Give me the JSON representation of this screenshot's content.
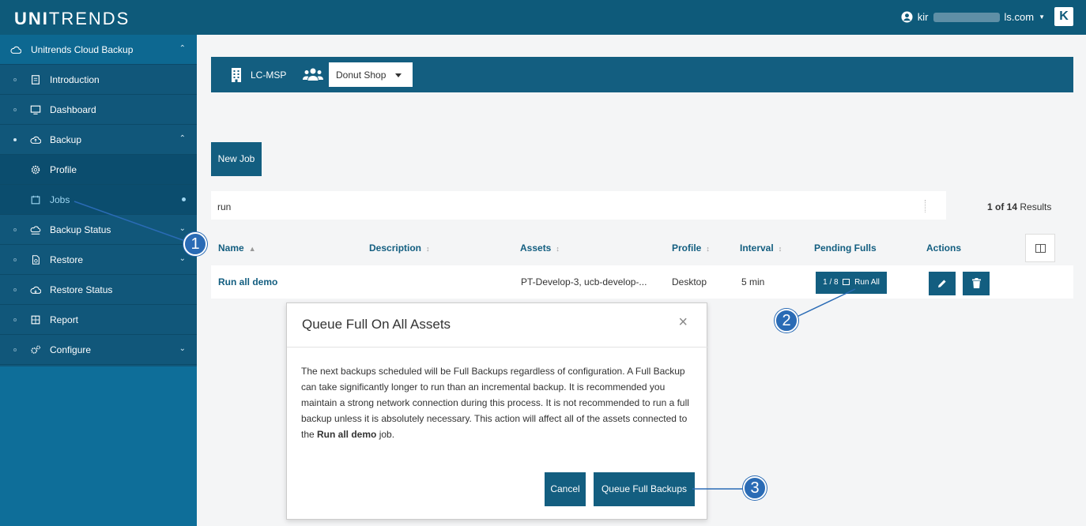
{
  "header": {
    "brand_bold": "UNI",
    "brand_rest": "TRENDS",
    "user_prefix": "kir",
    "user_suffix": "ls.com",
    "logo_letter": "K"
  },
  "sidebar": {
    "items": [
      {
        "label": "Unitrends Cloud Backup",
        "icon": "cloud-icon"
      },
      {
        "label": "Introduction",
        "icon": "document-icon"
      },
      {
        "label": "Dashboard",
        "icon": "monitor-icon"
      },
      {
        "label": "Backup",
        "icon": "cloud-upload-icon"
      },
      {
        "label": "Profile",
        "icon": "gear-icon"
      },
      {
        "label": "Jobs",
        "icon": "calendar-icon"
      },
      {
        "label": "Backup Status",
        "icon": "backup-status-icon"
      },
      {
        "label": "Restore",
        "icon": "file-restore-icon"
      },
      {
        "label": "Restore Status",
        "icon": "cloud-restore-icon"
      },
      {
        "label": "Report",
        "icon": "table-icon"
      },
      {
        "label": "Configure",
        "icon": "gears-icon"
      }
    ]
  },
  "context": {
    "org": "LC-MSP",
    "group": "Donut Shop"
  },
  "toolbar": {
    "new_job": "New Job"
  },
  "search": {
    "value": "run",
    "results_count": "1 of 14",
    "results_label": " Results"
  },
  "table": {
    "headers": [
      "Name",
      "Description",
      "Assets",
      "Profile",
      "Interval",
      "Pending Fulls",
      "Actions"
    ],
    "rows": [
      {
        "name": "Run all demo",
        "description": "",
        "assets": "PT-Develop-3, ucb-develop-...",
        "profile": "Desktop",
        "interval": "5 min",
        "pending": "1 / 8",
        "run_all": "Run All"
      }
    ]
  },
  "modal": {
    "title": "Queue Full On All Assets",
    "body_pre": "The next backups scheduled will be Full Backups regardless of configuration. A Full Backup can take significantly longer to run than an incremental backup. It is recommended you maintain a strong network connection during this process. It is not recommended to run a full backup unless it is absolutely necessary. This action will affect all of the assets connected to the ",
    "body_bold": "Run all demo",
    "body_post": " job.",
    "cancel": "Cancel",
    "confirm": "Queue Full Backups",
    "close": "×"
  },
  "callouts": [
    "1",
    "2",
    "3"
  ],
  "colors": {
    "header_bg": "#0e5a7a",
    "sidebar_bg": "#11577a",
    "accent": "#135e80",
    "callout": "#2a6bb5"
  }
}
